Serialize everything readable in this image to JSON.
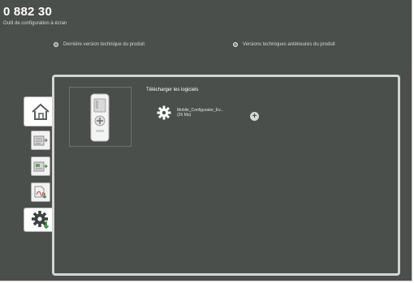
{
  "header": {
    "title": "0 882 30",
    "subtitle": "Outil de configuration à écran"
  },
  "version_links": {
    "latest": "Dernière version technique du produit",
    "previous": "Versions techniques antérieures du produit"
  },
  "sidebar": {
    "items": [
      {
        "name": "home",
        "icon": "home-icon"
      },
      {
        "name": "document-a",
        "icon": "document-arrow-icon"
      },
      {
        "name": "document-b",
        "icon": "document-arrow-icon"
      },
      {
        "name": "document-c",
        "icon": "pdf-download-icon"
      },
      {
        "name": "software",
        "icon": "gear-download-icon",
        "selected": true
      }
    ]
  },
  "content": {
    "section_title": "Télécharger les logiciels",
    "download": {
      "name": "Mobile_Configurator_Ev...",
      "size": "(26 Mo)",
      "action_icon": "plus-icon"
    }
  },
  "colors": {
    "background": "#4b4f4c",
    "panel_border": "#d4d4d4",
    "text": "#ffffff"
  }
}
